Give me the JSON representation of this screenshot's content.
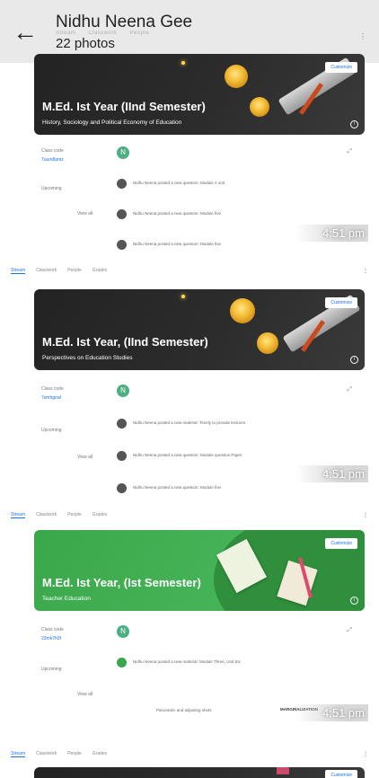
{
  "header": {
    "back_icon": "arrow-left-icon",
    "title": "Nidhu Neena Gee",
    "photo_count": "22 photos",
    "tabs": [
      "Stream",
      "Classwork",
      "People",
      "Grades"
    ]
  },
  "classes": [
    {
      "tabs": [
        "Stream",
        "Classwork",
        "People",
        "Grades"
      ],
      "banner_title": "M.Ed. Ist Year (IInd Semester)",
      "banner_subtitle": "History, Sociology and Political Economy of Education",
      "customize": "Customize",
      "theme": "dark",
      "class_code_label": "Class code",
      "class_code": "7uum8amz",
      "upcoming_label": "Upcoming",
      "avatar_letter": "N",
      "posts": [
        "Nidhu Neena posted a new question: Module 4 unit",
        "Nidhu Neena posted a new question: Module five",
        "Nidhu Neena posted a new question: Module five"
      ],
      "view_all": "View all",
      "time": "4:51 pm"
    },
    {
      "tabs": [
        "Stream",
        "Classwork",
        "People",
        "Grades"
      ],
      "banner_title": "M.Ed. Ist Year, (IInd Semester)",
      "banner_subtitle": "Perspectives on Education Studies",
      "customize": "Customize",
      "theme": "dark",
      "class_code_label": "Class code",
      "class_code": "7smhgcwl",
      "upcoming_label": "Upcoming",
      "avatar_letter": "N",
      "posts": [
        "Nidhu Neena posted a new material: Timely to provide lectures",
        "Nidhu Neena posted a new question: Module question Paper",
        "Nidhu Neena posted a new question: Module five"
      ],
      "view_all": "View all",
      "time": "4:51 pm"
    },
    {
      "tabs": [
        "Stream",
        "Classwork",
        "People",
        "Grades"
      ],
      "banner_title": "M.Ed. Ist Year, (Ist Semester)",
      "banner_subtitle": "Teacher Education",
      "customize": "Customize",
      "theme": "green",
      "class_code_label": "Class code",
      "class_code": "23mk7h3f",
      "upcoming_label": "Upcoming",
      "avatar_letter": "N",
      "posts": [
        "Nidhu Neena posted a new material: Module Three, Unit Six"
      ],
      "extra_row": "Panoramic and adjusting shots",
      "extra_right": "MARGINALIZATION",
      "view_all": "View all",
      "time": "4:51 pm"
    }
  ],
  "bottom_tabs": [
    "Stream",
    "Classwork",
    "People",
    "Grades"
  ],
  "bottom_customize": "Customize"
}
